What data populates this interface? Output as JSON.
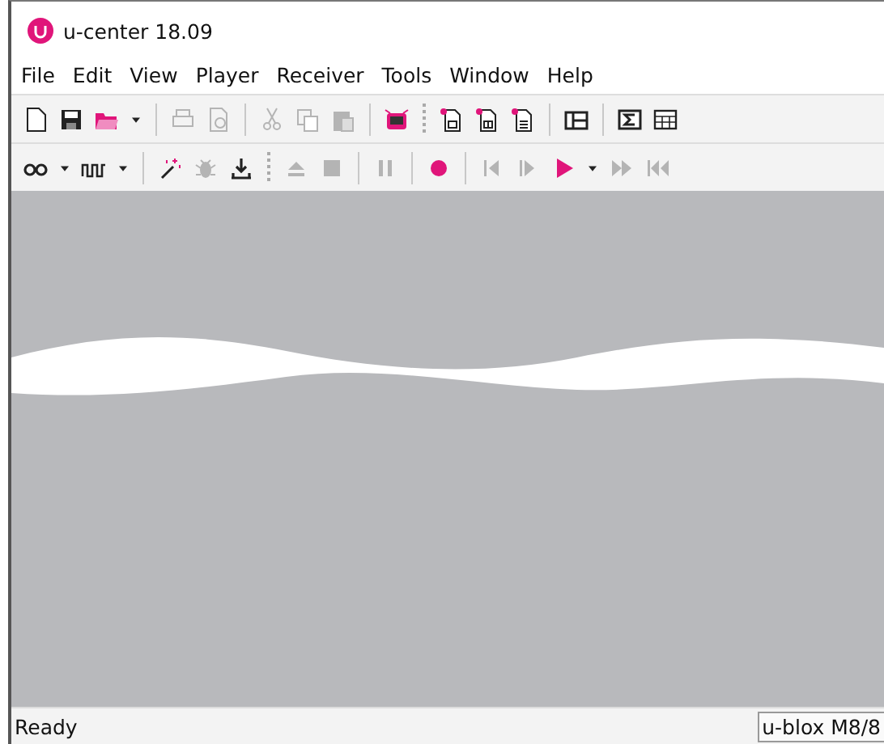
{
  "window": {
    "title": "u-center 18.09"
  },
  "menu": [
    "File",
    "Edit",
    "View",
    "Player",
    "Receiver",
    "Tools",
    "Window",
    "Help"
  ],
  "toolbars": [
    [
      {
        "kind": "new",
        "disabled": false
      },
      {
        "kind": "save",
        "disabled": false
      },
      {
        "kind": "open",
        "disabled": false
      },
      {
        "kind": "dropdown",
        "disabled": false
      },
      {
        "kind": "sep"
      },
      {
        "kind": "print",
        "disabled": true
      },
      {
        "kind": "preview",
        "disabled": true
      },
      {
        "kind": "sep"
      },
      {
        "kind": "cut",
        "disabled": true
      },
      {
        "kind": "copy",
        "disabled": true
      },
      {
        "kind": "paste",
        "disabled": true
      },
      {
        "kind": "sep"
      },
      {
        "kind": "device",
        "disabled": false
      },
      {
        "kind": "grip"
      },
      {
        "kind": "docexport",
        "disabled": false
      },
      {
        "kind": "docimport",
        "disabled": false
      },
      {
        "kind": "doclist",
        "disabled": false
      },
      {
        "kind": "sep"
      },
      {
        "kind": "panel",
        "disabled": false
      },
      {
        "kind": "sep"
      },
      {
        "kind": "sigma",
        "disabled": false
      },
      {
        "kind": "table",
        "disabled": false
      }
    ],
    [
      {
        "kind": "link",
        "disabled": false
      },
      {
        "kind": "dropdown",
        "disabled": false
      },
      {
        "kind": "pulse",
        "disabled": false
      },
      {
        "kind": "dropdown",
        "disabled": false
      },
      {
        "kind": "sep"
      },
      {
        "kind": "wand",
        "disabled": false
      },
      {
        "kind": "bug",
        "disabled": true
      },
      {
        "kind": "download",
        "disabled": false
      },
      {
        "kind": "grip"
      },
      {
        "kind": "eject",
        "disabled": true
      },
      {
        "kind": "stop",
        "disabled": true
      },
      {
        "kind": "sep"
      },
      {
        "kind": "pause",
        "disabled": true
      },
      {
        "kind": "sep"
      },
      {
        "kind": "record",
        "disabled": false
      },
      {
        "kind": "sep"
      },
      {
        "kind": "stepback",
        "disabled": true
      },
      {
        "kind": "stepfwd",
        "disabled": true
      },
      {
        "kind": "play",
        "disabled": false
      },
      {
        "kind": "dropdown",
        "disabled": false
      },
      {
        "kind": "ffwd",
        "disabled": true
      },
      {
        "kind": "tostart",
        "disabled": true
      }
    ]
  ],
  "status_bar": {
    "message": "Ready",
    "receiver": "u-blox M8/8"
  }
}
